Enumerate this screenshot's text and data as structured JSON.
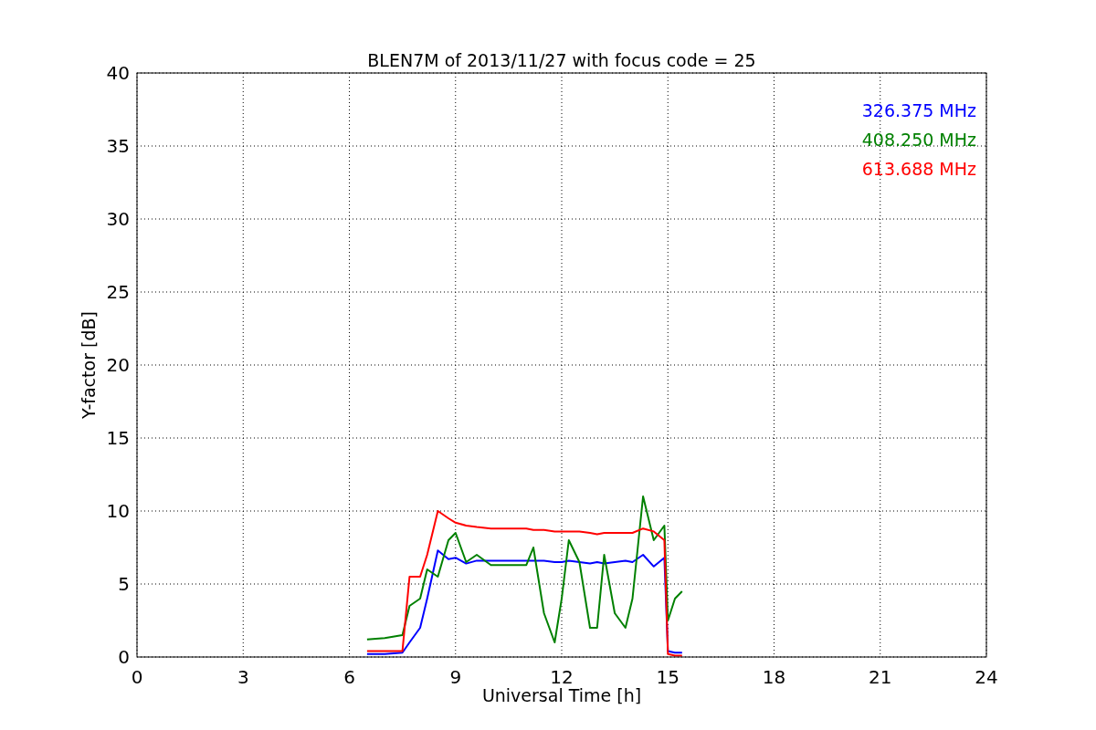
{
  "chart_data": {
    "type": "line",
    "title": "BLEN7M of 2013/11/27 with focus code = 25",
    "xlabel": "Universal Time [h]",
    "ylabel": "Y-factor [dB]",
    "x": [
      6.5,
      7,
      7.5,
      7.7,
      8,
      8.2,
      8.5,
      8.8,
      9,
      9.3,
      9.6,
      10,
      11,
      11.2,
      11.5,
      11.8,
      12,
      12.2,
      12.5,
      12.8,
      13,
      13.2,
      13.5,
      13.8,
      14,
      14.3,
      14.6,
      14.9,
      15,
      15.2,
      15.4
    ],
    "series": [
      {
        "name": "326.375 MHz",
        "color": "#0000ff",
        "values": [
          0.2,
          0.2,
          0.3,
          1,
          2,
          4,
          7.3,
          6.7,
          6.8,
          6.4,
          6.6,
          6.6,
          6.6,
          6.6,
          6.6,
          6.5,
          6.5,
          6.6,
          6.5,
          6.4,
          6.5,
          6.4,
          6.5,
          6.6,
          6.5,
          7,
          6.2,
          6.8,
          0.4,
          0.3,
          0.3
        ]
      },
      {
        "name": "408.250 MHz",
        "color": "#008000",
        "values": [
          1.2,
          1.3,
          1.5,
          3.5,
          4,
          6,
          5.5,
          8,
          8.5,
          6.5,
          7,
          6.3,
          6.3,
          7.5,
          3,
          1,
          4,
          8,
          6.5,
          2,
          2,
          7,
          3,
          2,
          4,
          11,
          8,
          9,
          2.5,
          4,
          4.5
        ]
      },
      {
        "name": "613.688 MHz",
        "color": "#ff0000",
        "values": [
          0.4,
          0.4,
          0.4,
          5.5,
          5.5,
          7,
          10,
          9.5,
          9.2,
          9,
          8.9,
          8.8,
          8.8,
          8.7,
          8.7,
          8.6,
          8.6,
          8.6,
          8.6,
          8.5,
          8.4,
          8.5,
          8.5,
          8.5,
          8.5,
          8.8,
          8.6,
          8,
          0.2,
          0.1,
          0.1
        ]
      }
    ],
    "xlim": [
      0,
      24
    ],
    "ylim": [
      0,
      40
    ],
    "xticks": [
      0,
      3,
      6,
      9,
      12,
      15,
      18,
      21,
      24
    ],
    "yticks": [
      0,
      5,
      10,
      15,
      20,
      25,
      30,
      35,
      40
    ],
    "grid": true
  }
}
